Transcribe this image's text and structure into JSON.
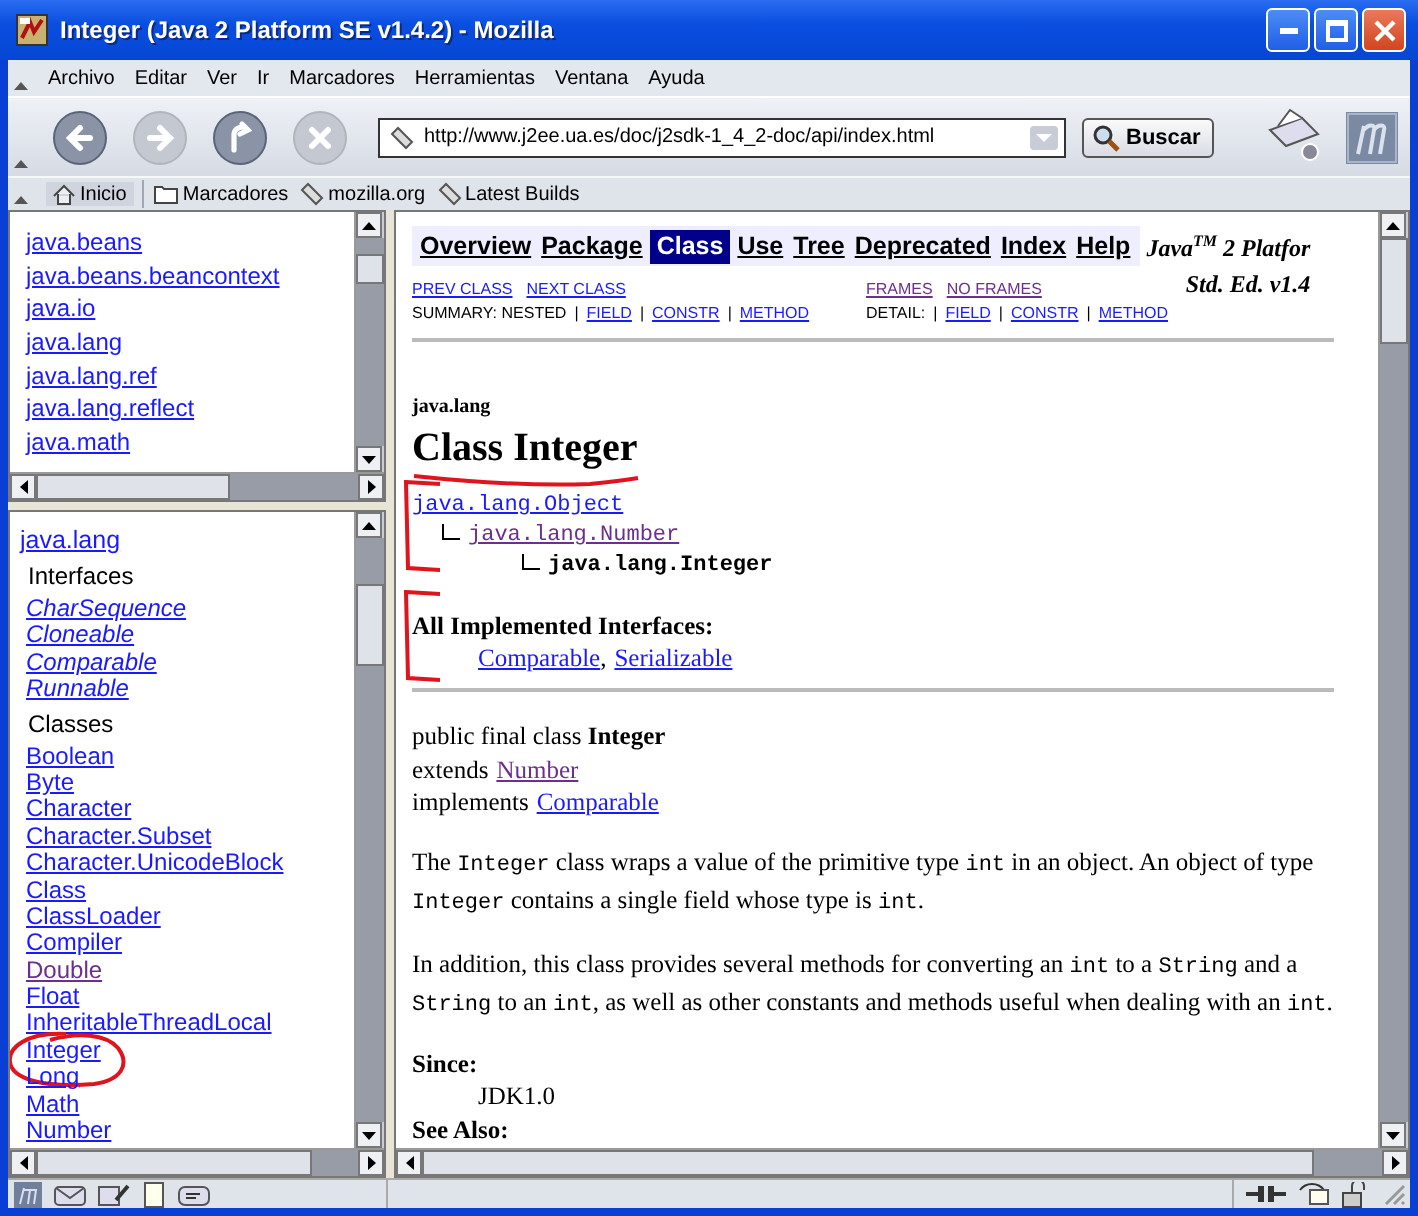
{
  "window": {
    "title": "Integer (Java 2 Platform SE v1.4.2) - Mozilla"
  },
  "menu": [
    "Archivo",
    "Editar",
    "Ver",
    "Ir",
    "Marcadores",
    "Herramientas",
    "Ventana",
    "Ayuda"
  ],
  "toolbar": {
    "buttons": [
      {
        "kind": "back",
        "disabled": false
      },
      {
        "kind": "forward",
        "disabled": true
      },
      {
        "kind": "reload",
        "disabled": false
      },
      {
        "kind": "stop",
        "disabled": true
      }
    ],
    "url": "http://www.j2ee.ua.es/doc/j2sdk-1_4_2-doc/api/index.html",
    "search_button": "Buscar"
  },
  "bookmarks": [
    {
      "kind": "home",
      "label": "Inicio"
    },
    {
      "kind": "folder",
      "label": "Marcadores"
    },
    {
      "kind": "bookmark",
      "label": "mozilla.org"
    },
    {
      "kind": "bookmark",
      "label": "Latest Builds"
    }
  ],
  "packages_frame": {
    "items": [
      {
        "label": "java.beans",
        "visited": false
      },
      {
        "label": "java.beans.beancontext",
        "visited": false
      },
      {
        "label": "java.io",
        "visited": false
      },
      {
        "label": "java.lang",
        "visited": false
      },
      {
        "label": "java.lang.ref",
        "visited": false
      },
      {
        "label": "java.lang.reflect",
        "visited": false
      },
      {
        "label": "java.math",
        "visited": false
      }
    ]
  },
  "classes_frame": {
    "package": "java.lang",
    "interfaces_heading": "Interfaces",
    "interfaces": [
      "CharSequence",
      "Cloneable",
      "Comparable",
      "Runnable"
    ],
    "classes_heading": "Classes",
    "classes": [
      {
        "label": "Boolean",
        "visited": false,
        "circled": false
      },
      {
        "label": "Byte",
        "visited": false,
        "circled": false
      },
      {
        "label": "Character",
        "visited": false,
        "circled": false
      },
      {
        "label": "Character.Subset",
        "visited": false,
        "circled": false
      },
      {
        "label": "Character.UnicodeBlock",
        "visited": false,
        "circled": false
      },
      {
        "label": "Class",
        "visited": false,
        "circled": false
      },
      {
        "label": "ClassLoader",
        "visited": false,
        "circled": false
      },
      {
        "label": "Compiler",
        "visited": false,
        "circled": false
      },
      {
        "label": "Double",
        "visited": true,
        "circled": false
      },
      {
        "label": "Float",
        "visited": false,
        "circled": false
      },
      {
        "label": "InheritableThreadLocal",
        "visited": false,
        "circled": false
      },
      {
        "label": "Integer",
        "visited": false,
        "circled": true
      },
      {
        "label": "Long",
        "visited": false,
        "circled": false
      },
      {
        "label": "Math",
        "visited": false,
        "circled": false
      },
      {
        "label": "Number",
        "visited": false,
        "circled": false
      }
    ]
  },
  "class_page": {
    "nav": [
      {
        "label": "Overview",
        "selected": false
      },
      {
        "label": "Package",
        "selected": false
      },
      {
        "label": "Class",
        "selected": true
      },
      {
        "label": "Use",
        "selected": false
      },
      {
        "label": "Tree",
        "selected": false
      },
      {
        "label": "Deprecated",
        "selected": false
      },
      {
        "label": "Index",
        "selected": false
      },
      {
        "label": "Help",
        "selected": false
      }
    ],
    "platform_lines": [
      "Java$^{TM}$ 2 Platfor",
      "Std. Ed. v1.4"
    ],
    "class_links": [
      {
        "label": "PREV CLASS",
        "visited": false
      },
      {
        "label": "NEXT CLASS",
        "visited": false
      }
    ],
    "frame_links": [
      {
        "label": "FRAMES",
        "visited": true
      },
      {
        "label": "NO FRAMES",
        "visited": true
      }
    ],
    "summary": {
      "label": "SUMMARY: NESTED",
      "separator": "|",
      "links": [
        "FIELD",
        "CONSTR",
        "METHOD"
      ]
    },
    "detail": {
      "label": "DETAIL:",
      "separator": "|",
      "links": [
        "FIELD",
        "CONSTR",
        "METHOD"
      ]
    },
    "package": "java.lang",
    "title": {
      "text": "Class Integer",
      "underlined": true
    },
    "hierarchy": {
      "bracketed": true,
      "root": {
        "label": "java.lang.Object",
        "link": true,
        "visited": false,
        "children": [
          {
            "label": "java.lang.Number",
            "link": true,
            "visited": true,
            "children": [
              {
                "label": "java.lang.Integer",
                "link": false
              }
            ]
          }
        ]
      }
    },
    "interfaces": {
      "bracketed": true,
      "heading": "All Implemented Interfaces:",
      "separator": ",",
      "links": [
        "Comparable",
        "Serializable"
      ]
    },
    "declaration": [
      {
        "kind": "text",
        "text": "public final class **Integer**"
      },
      {
        "kind": "link",
        "prefix": "extends",
        "link": "Number",
        "visited": true
      },
      {
        "kind": "link",
        "prefix": "implements",
        "link": "Comparable",
        "visited": false
      }
    ],
    "description": [
      [
        {
          "text": "The ",
          "code": false
        },
        {
          "text": "Integer",
          "code": true
        },
        {
          "text": " class wraps a value of the primitive type ",
          "code": false
        },
        {
          "text": "int",
          "code": true
        },
        {
          "text": " in an object. An object of type ",
          "code": false
        },
        {
          "text": "Integer",
          "code": true
        },
        {
          "text": " contains a single field whose type is ",
          "code": false
        },
        {
          "text": "int",
          "code": true
        },
        {
          "text": ".",
          "code": false
        }
      ],
      [
        {
          "text": "In addition, this class provides several methods for converting an ",
          "code": false
        },
        {
          "text": "int",
          "code": true
        },
        {
          "text": " to a ",
          "code": false
        },
        {
          "text": "String",
          "code": true
        },
        {
          "text": " and a ",
          "code": false
        },
        {
          "text": "String",
          "code": true
        },
        {
          "text": " to an ",
          "code": false
        },
        {
          "text": "int",
          "code": true
        },
        {
          "text": ", as well as other constants and methods useful when dealing with an ",
          "code": false
        },
        {
          "text": "int",
          "code": true
        },
        {
          "text": ".",
          "code": false
        }
      ]
    ],
    "since": {
      "label": "Since:",
      "value": "JDK1.0"
    },
    "see_also": {
      "label": "See Also:"
    }
  }
}
